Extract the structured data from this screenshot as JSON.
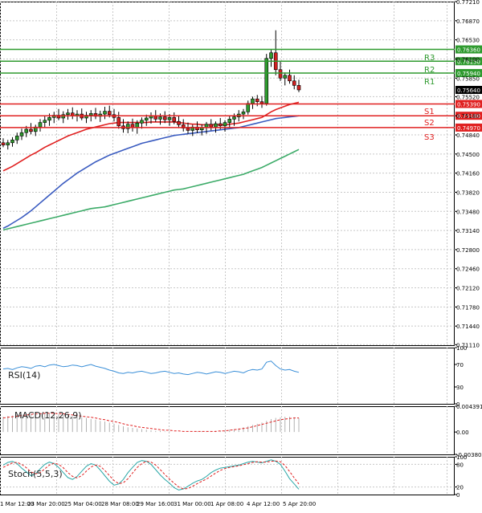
{
  "chart_data": [
    {
      "type": "line",
      "panel": "price",
      "title": "",
      "ylim": [
        0.711,
        0.7721
      ],
      "y_ticks": [
        "0.77210",
        "0.76870",
        "0.76530",
        "0.76190",
        "0.75850",
        "0.75520",
        "0.75180",
        "0.74840",
        "0.74500",
        "0.74160",
        "0.73820",
        "0.73480",
        "0.73140",
        "0.72800",
        "0.72460",
        "0.72120",
        "0.71780",
        "0.71440",
        "0.71110"
      ],
      "x_ticks": [
        "1 Mar 12:00",
        "23 Mar 20:00",
        "25 Mar 04:00",
        "28 Mar 08:00",
        "29 Mar 16:00",
        "31 Mar 00:00",
        "1 Apr 08:00",
        "4 Apr 12:00",
        "5 Apr 20:00"
      ],
      "grid": true,
      "levels": [
        {
          "name": "R3",
          "value": 0.7636,
          "label": "0.76360",
          "color": "#2e9a2e"
        },
        {
          "name": "R2",
          "value": 0.7615,
          "label": "0.76150",
          "color": "#2e9a2e"
        },
        {
          "name": "R1",
          "value": 0.7594,
          "label": "0.75940",
          "color": "#2e9a2e"
        },
        {
          "name": "S1",
          "value": 0.7539,
          "label": "0.75390",
          "color": "#e02020"
        },
        {
          "name": "S2",
          "value": 0.7518,
          "label": "0.75180",
          "color": "#e02020"
        },
        {
          "name": "S3",
          "value": 0.7497,
          "label": "0.74970",
          "color": "#e02020"
        }
      ],
      "last_price": {
        "value": 0.7564,
        "label": "0.75640"
      },
      "candles": [
        [
          0.747,
          0.7478,
          0.7462,
          0.7466
        ],
        [
          0.7466,
          0.7475,
          0.7458,
          0.747
        ],
        [
          0.747,
          0.748,
          0.7463,
          0.7475
        ],
        [
          0.7475,
          0.7488,
          0.7468,
          0.7482
        ],
        [
          0.7482,
          0.7495,
          0.7475,
          0.7488
        ],
        [
          0.7488,
          0.75,
          0.748,
          0.7494
        ],
        [
          0.7494,
          0.7505,
          0.7485,
          0.749
        ],
        [
          0.749,
          0.7502,
          0.7482,
          0.7498
        ],
        [
          0.7498,
          0.7512,
          0.749,
          0.7506
        ],
        [
          0.7506,
          0.7518,
          0.7497,
          0.751
        ],
        [
          0.751,
          0.7522,
          0.75,
          0.7515
        ],
        [
          0.7515,
          0.7525,
          0.7505,
          0.7519
        ],
        [
          0.7519,
          0.753,
          0.751,
          0.7514
        ],
        [
          0.7514,
          0.7526,
          0.7505,
          0.752
        ],
        [
          0.752,
          0.753,
          0.7511,
          0.7523
        ],
        [
          0.7523,
          0.7533,
          0.7512,
          0.7518
        ],
        [
          0.7518,
          0.7528,
          0.7508,
          0.7521
        ],
        [
          0.7521,
          0.7531,
          0.751,
          0.7514
        ],
        [
          0.7514,
          0.7525,
          0.7505,
          0.7519
        ],
        [
          0.7519,
          0.7528,
          0.7508,
          0.7522
        ],
        [
          0.7522,
          0.7532,
          0.7512,
          0.7517
        ],
        [
          0.7517,
          0.7527,
          0.7507,
          0.7521
        ],
        [
          0.7521,
          0.7534,
          0.7512,
          0.7526
        ],
        [
          0.7526,
          0.7536,
          0.7515,
          0.752
        ],
        [
          0.752,
          0.753,
          0.7508,
          0.7515
        ],
        [
          0.7515,
          0.7525,
          0.7495,
          0.75
        ],
        [
          0.75,
          0.7512,
          0.7488,
          0.7495
        ],
        [
          0.7495,
          0.7508,
          0.7487,
          0.7503
        ],
        [
          0.7503,
          0.7513,
          0.749,
          0.7497
        ],
        [
          0.7497,
          0.751,
          0.7486,
          0.7505
        ],
        [
          0.7505,
          0.7515,
          0.7495,
          0.751
        ],
        [
          0.751,
          0.752,
          0.75,
          0.7514
        ],
        [
          0.7514,
          0.7524,
          0.7504,
          0.7518
        ],
        [
          0.7518,
          0.7528,
          0.7507,
          0.7512
        ],
        [
          0.7512,
          0.7522,
          0.7502,
          0.7516
        ],
        [
          0.7516,
          0.7526,
          0.7505,
          0.7511
        ],
        [
          0.7511,
          0.7521,
          0.75,
          0.7515
        ],
        [
          0.7515,
          0.7524,
          0.7503,
          0.7508
        ],
        [
          0.7508,
          0.7518,
          0.7496,
          0.7502
        ],
        [
          0.7502,
          0.7512,
          0.749,
          0.7496
        ],
        [
          0.7496,
          0.7506,
          0.7486,
          0.7492
        ],
        [
          0.7492,
          0.7502,
          0.7482,
          0.7498
        ],
        [
          0.7498,
          0.7508,
          0.7487,
          0.7493
        ],
        [
          0.7493,
          0.7503,
          0.7483,
          0.7497
        ],
        [
          0.7497,
          0.7507,
          0.7486,
          0.7503
        ],
        [
          0.7503,
          0.7512,
          0.7492,
          0.7498
        ],
        [
          0.7498,
          0.7508,
          0.7488,
          0.7504
        ],
        [
          0.7504,
          0.7514,
          0.7494,
          0.75
        ],
        [
          0.75,
          0.751,
          0.749,
          0.7506
        ],
        [
          0.7506,
          0.7517,
          0.7497,
          0.7512
        ],
        [
          0.7512,
          0.7522,
          0.75,
          0.7516
        ],
        [
          0.7516,
          0.7528,
          0.7508,
          0.7521
        ],
        [
          0.7521,
          0.753,
          0.7512,
          0.7525
        ],
        [
          0.7525,
          0.7545,
          0.752,
          0.754
        ],
        [
          0.754,
          0.7552,
          0.753,
          0.7548
        ],
        [
          0.7548,
          0.7555,
          0.7535,
          0.7543
        ],
        [
          0.7543,
          0.7553,
          0.7532,
          0.754
        ],
        [
          0.754,
          0.7628,
          0.7536,
          0.762
        ],
        [
          0.762,
          0.7635,
          0.7605,
          0.763
        ],
        [
          0.763,
          0.767,
          0.759,
          0.76
        ],
        [
          0.76,
          0.7615,
          0.758,
          0.7585
        ],
        [
          0.7585,
          0.7595,
          0.7572,
          0.759
        ],
        [
          0.759,
          0.76,
          0.7575,
          0.758
        ],
        [
          0.758,
          0.759,
          0.7565,
          0.7572
        ],
        [
          0.7572,
          0.7582,
          0.756,
          0.7564
        ]
      ],
      "series": [
        {
          "role": "ma-fast",
          "color": "#e02020",
          "values": [
            0.742,
            0.7424,
            0.7428,
            0.7433,
            0.7438,
            0.7443,
            0.7448,
            0.7452,
            0.7457,
            0.7462,
            0.7466,
            0.747,
            0.7474,
            0.7478,
            0.7482,
            0.7485,
            0.7488,
            0.7491,
            0.7494,
            0.7496,
            0.7498,
            0.75,
            0.7502,
            0.7504,
            0.7505,
            0.7506,
            0.7506,
            0.7506,
            0.7506,
            0.7506,
            0.7506,
            0.7506,
            0.7507,
            0.7507,
            0.7507,
            0.7507,
            0.7507,
            0.7507,
            0.7506,
            0.7505,
            0.7504,
            0.7503,
            0.7503,
            0.7502,
            0.7502,
            0.7502,
            0.7502,
            0.7502,
            0.7502,
            0.7503,
            0.7504,
            0.7505,
            0.7507,
            0.7509,
            0.7511,
            0.7513,
            0.7515,
            0.752,
            0.7525,
            0.7529,
            0.7532,
            0.7535,
            0.7538,
            0.754,
            0.7542
          ]
        },
        {
          "role": "ma-mid",
          "color": "#3a5bc0",
          "values": [
            0.7318,
            0.7322,
            0.7327,
            0.7332,
            0.7337,
            0.7343,
            0.7349,
            0.7356,
            0.7363,
            0.737,
            0.7377,
            0.7384,
            0.7391,
            0.7398,
            0.7404,
            0.741,
            0.7416,
            0.7421,
            0.7426,
            0.7431,
            0.7436,
            0.744,
            0.7444,
            0.7448,
            0.7451,
            0.7454,
            0.7457,
            0.746,
            0.7463,
            0.7466,
            0.7469,
            0.7471,
            0.7473,
            0.7475,
            0.7477,
            0.7479,
            0.7481,
            0.7483,
            0.7484,
            0.7485,
            0.7486,
            0.7487,
            0.7488,
            0.7489,
            0.749,
            0.7491,
            0.7492,
            0.7493,
            0.7494,
            0.7495,
            0.7496,
            0.7497,
            0.7499,
            0.7501,
            0.7503,
            0.7505,
            0.7507,
            0.7509,
            0.7511,
            0.7513,
            0.7514,
            0.7515,
            0.7516,
            0.7517,
            0.7518
          ]
        },
        {
          "role": "ma-slow",
          "color": "#3cab68",
          "values": [
            0.7315,
            0.7317,
            0.7319,
            0.7321,
            0.7323,
            0.7325,
            0.7327,
            0.7329,
            0.7331,
            0.7333,
            0.7335,
            0.7337,
            0.7339,
            0.7341,
            0.7343,
            0.7345,
            0.7347,
            0.7349,
            0.7351,
            0.7353,
            0.7354,
            0.7355,
            0.7356,
            0.7358,
            0.736,
            0.7362,
            0.7364,
            0.7366,
            0.7368,
            0.737,
            0.7372,
            0.7374,
            0.7376,
            0.7378,
            0.738,
            0.7382,
            0.7384,
            0.7386,
            0.7387,
            0.7388,
            0.739,
            0.7392,
            0.7394,
            0.7396,
            0.7398,
            0.74,
            0.7402,
            0.7404,
            0.7406,
            0.7408,
            0.741,
            0.7412,
            0.7414,
            0.7417,
            0.742,
            0.7423,
            0.7426,
            0.743,
            0.7434,
            0.7438,
            0.7442,
            0.7446,
            0.745,
            0.7454,
            0.7458
          ]
        }
      ]
    },
    {
      "type": "line",
      "panel": "rsi",
      "title": "RSI(14)",
      "ylim": [
        0,
        100
      ],
      "y_ticks": [
        "100",
        "70",
        "30",
        "0"
      ],
      "series": [
        {
          "role": "rsi",
          "color": "#3a8fd8",
          "values": [
            62,
            63,
            61,
            64,
            66,
            65,
            63,
            67,
            68,
            66,
            69,
            70,
            68,
            66,
            67,
            69,
            68,
            66,
            68,
            70,
            67,
            65,
            63,
            60,
            58,
            55,
            54,
            56,
            55,
            57,
            58,
            56,
            54,
            55,
            57,
            58,
            56,
            54,
            55,
            53,
            52,
            54,
            56,
            55,
            53,
            55,
            57,
            56,
            54,
            56,
            58,
            57,
            55,
            59,
            61,
            60,
            62,
            74,
            76,
            68,
            62,
            60,
            61,
            58,
            56
          ]
        }
      ]
    },
    {
      "type": "bar",
      "panel": "macd",
      "title": "MACD(12,26,9)",
      "ylim": [
        -0.003806,
        0.004391
      ],
      "y_ticks": [
        "0.004391",
        "0.00",
        "-0.003806"
      ],
      "series": [
        {
          "role": "histogram",
          "color": "#b0b0b0",
          "values": [
            0.0026,
            0.0027,
            0.0028,
            0.0029,
            0.003,
            0.0031,
            0.0031,
            0.0032,
            0.0032,
            0.0032,
            0.0032,
            0.0031,
            0.003,
            0.0029,
            0.0028,
            0.0027,
            0.0026,
            0.0025,
            0.0024,
            0.0022,
            0.0021,
            0.0019,
            0.0018,
            0.0016,
            0.0014,
            0.0012,
            0.001,
            0.0008,
            0.0007,
            0.0006,
            0.0005,
            0.0004,
            0.0003,
            0.0002,
            0.0002,
            0.0001,
            0.0001,
            0.0,
            0.0,
            0.0,
            0.0,
            0.0,
            0.0001,
            0.0001,
            0.0001,
            0.0001,
            0.0002,
            0.0002,
            0.0003,
            0.0004,
            0.0005,
            0.0006,
            0.0008,
            0.001,
            0.0012,
            0.0014,
            0.0016,
            0.0019,
            0.0022,
            0.0024,
            0.0025,
            0.0026,
            0.0026,
            0.0025,
            0.0024
          ]
        },
        {
          "role": "signal",
          "color": "#e02020",
          "values": [
            0.0024,
            0.0025,
            0.0026,
            0.0027,
            0.0028,
            0.0029,
            0.003,
            0.0031,
            0.0031,
            0.0032,
            0.0032,
            0.0032,
            0.0031,
            0.0031,
            0.003,
            0.0029,
            0.0028,
            0.0027,
            0.0026,
            0.0025,
            0.0024,
            0.0022,
            0.0021,
            0.0019,
            0.0018,
            0.0016,
            0.0014,
            0.0012,
            0.0011,
            0.0009,
            0.0008,
            0.0007,
            0.0006,
            0.0005,
            0.0004,
            0.0003,
            0.0003,
            0.0002,
            0.0002,
            0.0001,
            0.0001,
            0.0001,
            0.0001,
            0.0001,
            0.0001,
            0.0001,
            0.0001,
            0.0002,
            0.0002,
            0.0003,
            0.0004,
            0.0005,
            0.0006,
            0.0007,
            0.0009,
            0.0011,
            0.0013,
            0.0015,
            0.0017,
            0.0019,
            0.0021,
            0.0022,
            0.0023,
            0.0024,
            0.0024
          ]
        }
      ]
    },
    {
      "type": "line",
      "panel": "stoch",
      "title": "Stoch(5,5,3)",
      "ylim": [
        0,
        100
      ],
      "y_ticks": [
        "100",
        "80",
        "20",
        "0"
      ],
      "series": [
        {
          "role": "k",
          "color": "#2aa7a7",
          "values": [
            78,
            85,
            88,
            82,
            70,
            60,
            50,
            55,
            68,
            80,
            86,
            82,
            72,
            58,
            45,
            40,
            48,
            62,
            75,
            82,
            78,
            65,
            50,
            35,
            25,
            28,
            40,
            58,
            72,
            85,
            90,
            88,
            80,
            66,
            52,
            40,
            30,
            18,
            12,
            15,
            22,
            30,
            36,
            40,
            48,
            58,
            65,
            70,
            72,
            74,
            76,
            78,
            82,
            86,
            88,
            86,
            84,
            88,
            92,
            88,
            80,
            62,
            42,
            28,
            14
          ]
        },
        {
          "role": "d",
          "color": "#e02020",
          "values": [
            72,
            78,
            84,
            85,
            80,
            71,
            60,
            55,
            58,
            68,
            78,
            83,
            80,
            71,
            58,
            48,
            44,
            50,
            62,
            73,
            78,
            75,
            64,
            50,
            37,
            29,
            31,
            42,
            57,
            72,
            82,
            88,
            86,
            78,
            66,
            53,
            41,
            30,
            20,
            15,
            16,
            22,
            29,
            35,
            41,
            49,
            57,
            64,
            69,
            72,
            74,
            76,
            79,
            82,
            85,
            87,
            86,
            86,
            88,
            89,
            87,
            77,
            61,
            44,
            28
          ]
        }
      ]
    }
  ]
}
